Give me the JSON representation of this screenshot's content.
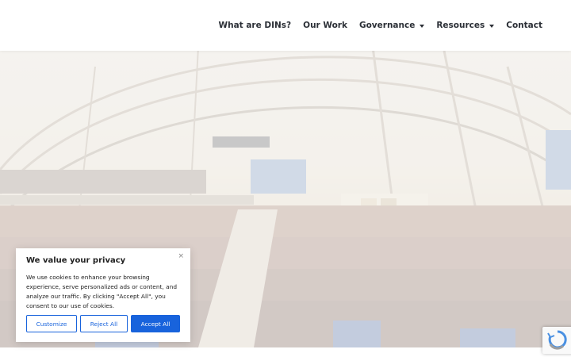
{
  "header": {
    "nav": [
      {
        "label": "What are DINs?"
      },
      {
        "label": "Our Work"
      },
      {
        "label": "Governance",
        "has_dropdown": true
      },
      {
        "label": "Resources",
        "has_dropdown": true
      },
      {
        "label": "Contact"
      }
    ]
  },
  "hero": {
    "image": "parliamentary-chamber-photo"
  },
  "cookie_banner": {
    "title": "We value your privacy",
    "close_symbol": "×",
    "text": "We use cookies to enhance your browsing experience, serve personalized ads or content, and analyze our traffic. By clicking \"Accept All\", you consent to our use of cookies.",
    "customize_label": "Customize",
    "reject_label": "Reject All",
    "accept_label": "Accept All"
  },
  "colors": {
    "accent": "#1863dc",
    "nav_text": "#2b2f36"
  },
  "recaptcha": {
    "icon": "recaptcha-icon"
  }
}
